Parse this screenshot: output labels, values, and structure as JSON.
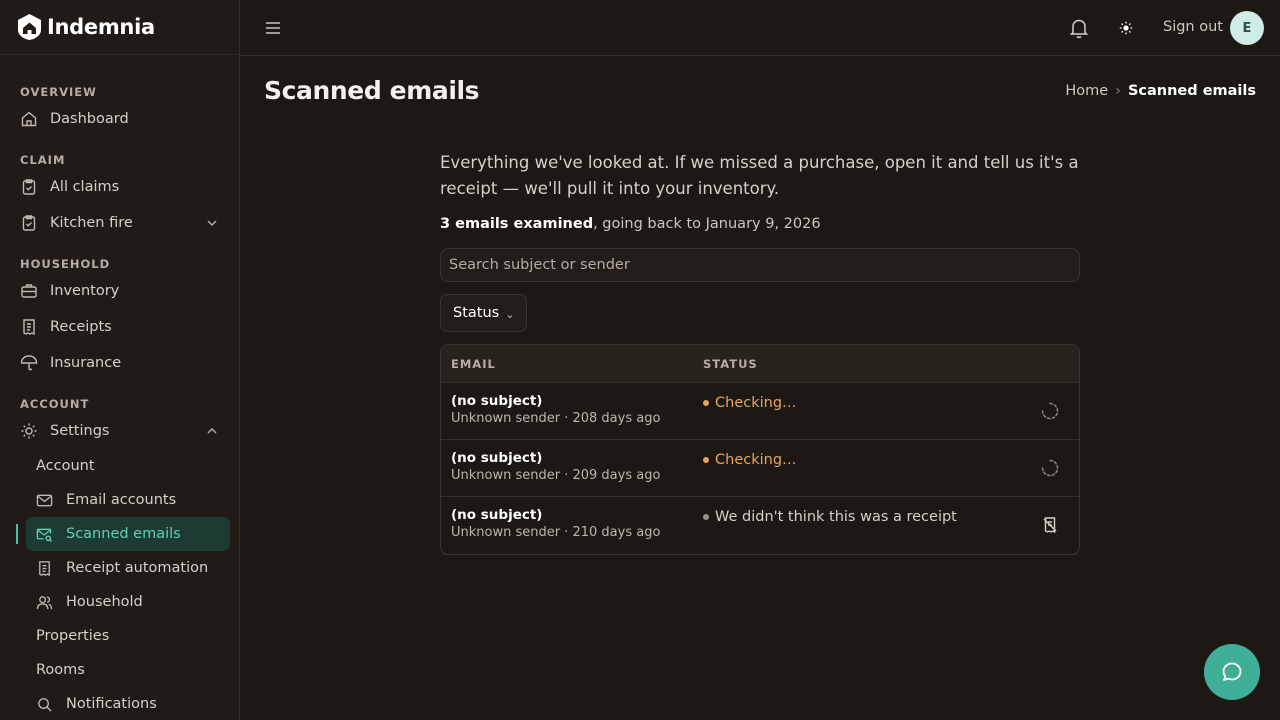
{
  "brand": {
    "name": "Indemnia"
  },
  "colors": {
    "accent": "#43c2a6",
    "checking": "#e8a65d",
    "muted_dot": "#9a9189"
  },
  "sidebar": {
    "sections": {
      "overview": "OVERVIEW",
      "claim": "CLAIM",
      "household": "HOUSEHOLD",
      "account": "ACCOUNT"
    },
    "items": {
      "dashboard": "Dashboard",
      "all_claims": "All claims",
      "kitchen_fire": "Kitchen fire",
      "inventory": "Inventory",
      "receipts": "Receipts",
      "insurance": "Insurance",
      "settings": "Settings",
      "account": "Account",
      "email_accounts": "Email accounts",
      "scanned_emails": "Scanned emails",
      "receipt_automation": "Receipt automation",
      "household": "Household",
      "properties": "Properties",
      "rooms": "Rooms",
      "notifications": "Notifications"
    }
  },
  "topbar": {
    "sign_out": "Sign out",
    "avatar_initial": "E"
  },
  "page": {
    "title": "Scanned emails",
    "breadcrumb": {
      "home": "Home",
      "sep": "›",
      "current": "Scanned emails"
    },
    "intro": "Everything we've looked at. If we missed a purchase, open it and tell us it's a receipt — we'll pull it into your inventory.",
    "summary_bold": "3 emails examined",
    "summary_rest": ", going back to January 9, 2026",
    "search_placeholder": "Search subject or sender",
    "filter_label": "Status",
    "filter_caret": "⌄"
  },
  "table": {
    "columns": {
      "email": "EMAIL",
      "status": "STATUS"
    },
    "rows": [
      {
        "subject": "(no subject)",
        "meta": "Unknown sender · 208 days ago",
        "status": "Checking…",
        "state": "checking"
      },
      {
        "subject": "(no subject)",
        "meta": "Unknown sender · 209 days ago",
        "status": "Checking…",
        "state": "checking"
      },
      {
        "subject": "(no subject)",
        "meta": "Unknown sender · 210 days ago",
        "status": "We didn't think this was a receipt",
        "state": "not-receipt"
      }
    ]
  }
}
